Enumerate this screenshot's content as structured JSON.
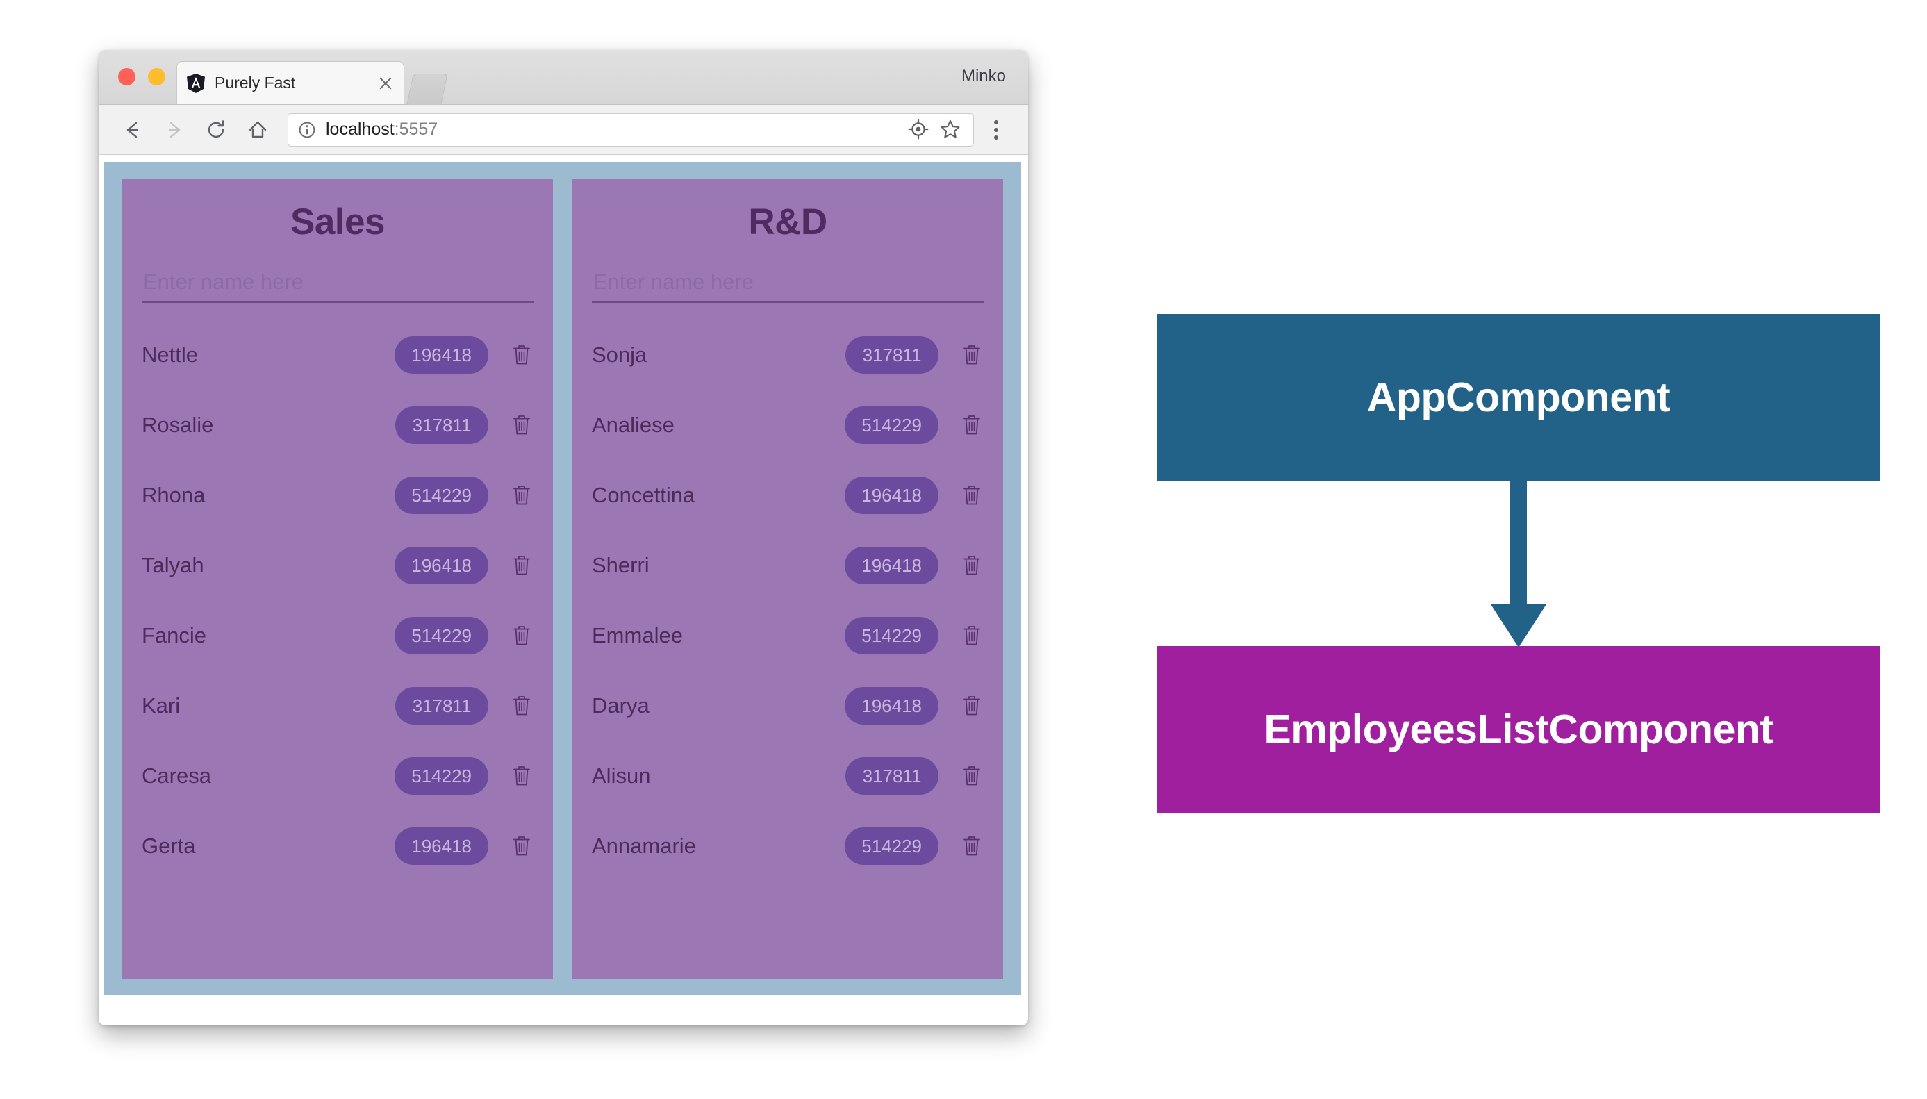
{
  "browser": {
    "profile_name": "Minko",
    "tab": {
      "title": "Purely Fast",
      "favicon": "angular-logo-icon",
      "close_label": "×"
    },
    "toolbar": {
      "back_icon": "back-arrow-icon",
      "forward_icon": "forward-arrow-icon",
      "reload_icon": "reload-icon",
      "home_icon": "home-icon",
      "info_icon": "info-circle-icon",
      "url_host": "localhost",
      "url_port": ":5557",
      "location_icon": "location-target-icon",
      "bookmark_icon": "star-icon",
      "menu_icon": "three-dot-menu-icon"
    }
  },
  "app": {
    "colors": {
      "shell_background": "#9cbad0",
      "panel_background": "#9b78b4",
      "title_text": "#4f2b61",
      "badge_background": "#6c4b9e",
      "badge_text": "#c9b6dc"
    },
    "panels": [
      {
        "title": "Sales",
        "input_placeholder": "Enter name here",
        "input_value": "",
        "employees": [
          {
            "name": "Nettle",
            "value": "196418"
          },
          {
            "name": "Rosalie",
            "value": "317811"
          },
          {
            "name": "Rhona",
            "value": "514229"
          },
          {
            "name": "Talyah",
            "value": "196418"
          },
          {
            "name": "Fancie",
            "value": "514229"
          },
          {
            "name": "Kari",
            "value": "317811"
          },
          {
            "name": "Caresa",
            "value": "514229"
          },
          {
            "name": "Gerta",
            "value": "196418"
          }
        ]
      },
      {
        "title": "R&D",
        "input_placeholder": "Enter name here",
        "input_value": "",
        "employees": [
          {
            "name": "Sonja",
            "value": "317811"
          },
          {
            "name": "Analiese",
            "value": "514229"
          },
          {
            "name": "Concettina",
            "value": "196418"
          },
          {
            "name": "Sherri",
            "value": "196418"
          },
          {
            "name": "Emmalee",
            "value": "514229"
          },
          {
            "name": "Darya",
            "value": "196418"
          },
          {
            "name": "Alisun",
            "value": "317811"
          },
          {
            "name": "Annamarie",
            "value": "514229"
          }
        ]
      }
    ],
    "delete_icon": "trash-icon"
  },
  "diagram": {
    "nodes": [
      {
        "label": "AppComponent",
        "color": "#226288"
      },
      {
        "label": "EmployeesListComponent",
        "color": "#9f1f9f"
      }
    ],
    "arrow": {
      "icon": "down-arrow-icon",
      "color": "#226288"
    }
  }
}
